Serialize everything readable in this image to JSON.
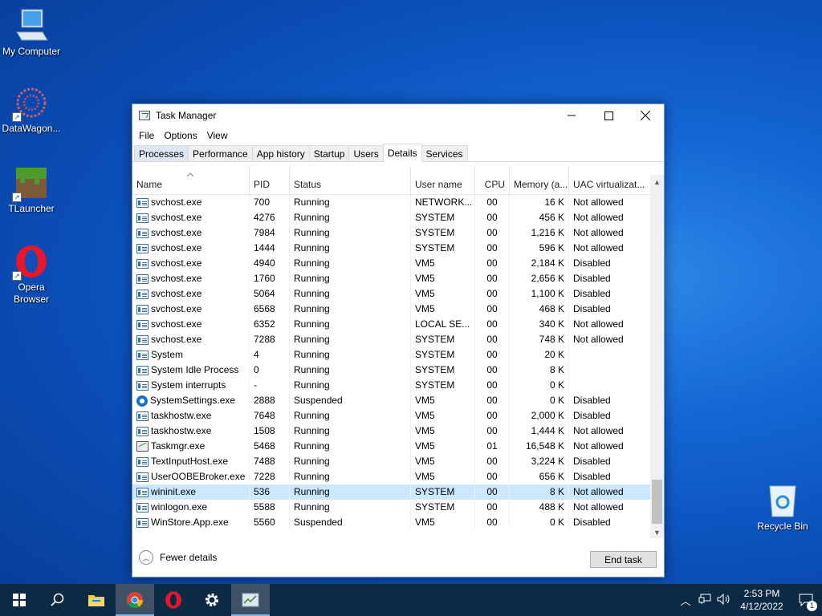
{
  "desktop": {
    "icons": [
      {
        "label": "My Computer"
      },
      {
        "label": "DataWagon..."
      },
      {
        "label": "TLauncher"
      },
      {
        "label": "Opera Browser"
      },
      {
        "label": "Recycle Bin"
      }
    ]
  },
  "window": {
    "title": "Task Manager",
    "menu": [
      "File",
      "Options",
      "View"
    ],
    "tabs": [
      "Processes",
      "Performance",
      "App history",
      "Startup",
      "Users",
      "Details",
      "Services"
    ],
    "active_tab": "Details",
    "columns": [
      "Name",
      "PID",
      "Status",
      "User name",
      "CPU",
      "Memory (a...",
      "UAC virtualizat..."
    ],
    "rows": [
      {
        "name": "svchost.exe",
        "pid": "700",
        "status": "Running",
        "user": "NETWORK...",
        "cpu": "00",
        "mem": "16 K",
        "uac": "Not allowed",
        "icon": "process-icon"
      },
      {
        "name": "svchost.exe",
        "pid": "4276",
        "status": "Running",
        "user": "SYSTEM",
        "cpu": "00",
        "mem": "456 K",
        "uac": "Not allowed",
        "icon": "process-icon"
      },
      {
        "name": "svchost.exe",
        "pid": "7984",
        "status": "Running",
        "user": "SYSTEM",
        "cpu": "00",
        "mem": "1,216 K",
        "uac": "Not allowed",
        "icon": "process-icon"
      },
      {
        "name": "svchost.exe",
        "pid": "1444",
        "status": "Running",
        "user": "SYSTEM",
        "cpu": "00",
        "mem": "596 K",
        "uac": "Not allowed",
        "icon": "process-icon"
      },
      {
        "name": "svchost.exe",
        "pid": "4940",
        "status": "Running",
        "user": "VM5",
        "cpu": "00",
        "mem": "2,184 K",
        "uac": "Disabled",
        "icon": "process-icon"
      },
      {
        "name": "svchost.exe",
        "pid": "1760",
        "status": "Running",
        "user": "VM5",
        "cpu": "00",
        "mem": "2,656 K",
        "uac": "Disabled",
        "icon": "process-icon"
      },
      {
        "name": "svchost.exe",
        "pid": "5064",
        "status": "Running",
        "user": "VM5",
        "cpu": "00",
        "mem": "1,100 K",
        "uac": "Disabled",
        "icon": "process-icon"
      },
      {
        "name": "svchost.exe",
        "pid": "6568",
        "status": "Running",
        "user": "VM5",
        "cpu": "00",
        "mem": "468 K",
        "uac": "Disabled",
        "icon": "process-icon"
      },
      {
        "name": "svchost.exe",
        "pid": "6352",
        "status": "Running",
        "user": "LOCAL SE...",
        "cpu": "00",
        "mem": "340 K",
        "uac": "Not allowed",
        "icon": "process-icon"
      },
      {
        "name": "svchost.exe",
        "pid": "7288",
        "status": "Running",
        "user": "SYSTEM",
        "cpu": "00",
        "mem": "748 K",
        "uac": "Not allowed",
        "icon": "process-icon"
      },
      {
        "name": "System",
        "pid": "4",
        "status": "Running",
        "user": "SYSTEM",
        "cpu": "00",
        "mem": "20 K",
        "uac": "",
        "icon": "process-icon"
      },
      {
        "name": "System Idle Process",
        "pid": "0",
        "status": "Running",
        "user": "SYSTEM",
        "cpu": "00",
        "mem": "8 K",
        "uac": "",
        "icon": "process-icon"
      },
      {
        "name": "System interrupts",
        "pid": "-",
        "status": "Running",
        "user": "SYSTEM",
        "cpu": "00",
        "mem": "0 K",
        "uac": "",
        "icon": "process-icon"
      },
      {
        "name": "SystemSettings.exe",
        "pid": "2888",
        "status": "Suspended",
        "user": "VM5",
        "cpu": "00",
        "mem": "0 K",
        "uac": "Disabled",
        "icon": "settings-gear-icon"
      },
      {
        "name": "taskhostw.exe",
        "pid": "7648",
        "status": "Running",
        "user": "VM5",
        "cpu": "00",
        "mem": "2,000 K",
        "uac": "Disabled",
        "icon": "process-icon"
      },
      {
        "name": "taskhostw.exe",
        "pid": "1508",
        "status": "Running",
        "user": "VM5",
        "cpu": "00",
        "mem": "1,444 K",
        "uac": "Not allowed",
        "icon": "process-icon"
      },
      {
        "name": "Taskmgr.exe",
        "pid": "5468",
        "status": "Running",
        "user": "VM5",
        "cpu": "01",
        "mem": "16,548 K",
        "uac": "Not allowed",
        "icon": "task-manager-icon"
      },
      {
        "name": "TextInputHost.exe",
        "pid": "7488",
        "status": "Running",
        "user": "VM5",
        "cpu": "00",
        "mem": "3,224 K",
        "uac": "Disabled",
        "icon": "process-icon"
      },
      {
        "name": "UserOOBEBroker.exe",
        "pid": "7228",
        "status": "Running",
        "user": "VM5",
        "cpu": "00",
        "mem": "656 K",
        "uac": "Disabled",
        "icon": "process-icon"
      },
      {
        "name": "wininit.exe",
        "pid": "536",
        "status": "Running",
        "user": "SYSTEM",
        "cpu": "00",
        "mem": "8 K",
        "uac": "Not allowed",
        "icon": "process-icon",
        "selected": true
      },
      {
        "name": "winlogon.exe",
        "pid": "5588",
        "status": "Running",
        "user": "SYSTEM",
        "cpu": "00",
        "mem": "488 K",
        "uac": "Not allowed",
        "icon": "process-icon"
      },
      {
        "name": "WinStore.App.exe",
        "pid": "5560",
        "status": "Suspended",
        "user": "VM5",
        "cpu": "00",
        "mem": "0 K",
        "uac": "Disabled",
        "icon": "process-icon"
      }
    ],
    "fewer_details": "Fewer details",
    "end_task": "End task"
  },
  "taskbar": {
    "clock_time": "2:53 PM",
    "clock_date": "4/12/2022",
    "notification_count": "1"
  },
  "colors": {
    "selected_row": "#cce8ff",
    "taskbar": "#0c2a44",
    "accent": "#1467d3"
  }
}
